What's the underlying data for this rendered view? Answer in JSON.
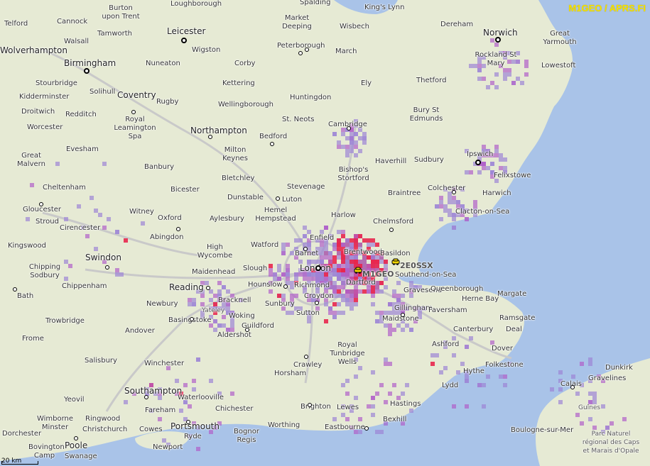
{
  "attribution": "M1GEO / APRS.FI",
  "scale_label": "20 km",
  "colors": {
    "land": "#e6ead4",
    "sea": "#a9c3e8",
    "motorway": "#c9c9c9",
    "coverage_low": "#9c84d6",
    "coverage_mid": "#b05fc9",
    "coverage_high": "#e8274e",
    "attribution": "#f5e200"
  },
  "stations": [
    {
      "callsign": "M1GEO",
      "icon": "car-icon"
    },
    {
      "callsign": "2E0SSX",
      "icon": "car-icon"
    }
  ],
  "places": [
    {
      "name": "Loughborough"
    },
    {
      "name": "Spalding"
    },
    {
      "name": "King's Lynn"
    },
    {
      "name": "Burton upon Trent"
    },
    {
      "name": "Telford"
    },
    {
      "name": "Cannock"
    },
    {
      "name": "Market Deeping"
    },
    {
      "name": "Wisbech"
    },
    {
      "name": "Dereham"
    },
    {
      "name": "Norwich"
    },
    {
      "name": "Great Yarmouth"
    },
    {
      "name": "Tamworth"
    },
    {
      "name": "Leicester"
    },
    {
      "name": "Walsall"
    },
    {
      "name": "Wolverhampton"
    },
    {
      "name": "Wigston"
    },
    {
      "name": "Peterborough"
    },
    {
      "name": "March"
    },
    {
      "name": "Rockland St Mary"
    },
    {
      "name": "Lowestoft"
    },
    {
      "name": "Birmingham"
    },
    {
      "name": "Nuneaton"
    },
    {
      "name": "Corby"
    },
    {
      "name": "Stourbridge"
    },
    {
      "name": "Solihull"
    },
    {
      "name": "Kettering"
    },
    {
      "name": "Ely"
    },
    {
      "name": "Thetford"
    },
    {
      "name": "Kidderminster"
    },
    {
      "name": "Coventry"
    },
    {
      "name": "Huntingdon"
    },
    {
      "name": "Rugby"
    },
    {
      "name": "Wellingborough"
    },
    {
      "name": "Bury St Edmunds"
    },
    {
      "name": "Droitwich"
    },
    {
      "name": "Redditch"
    },
    {
      "name": "St. Neots"
    },
    {
      "name": "Cambridge"
    },
    {
      "name": "Worcester"
    },
    {
      "name": "Royal Leamington Spa"
    },
    {
      "name": "Northampton"
    },
    {
      "name": "Bedford"
    },
    {
      "name": "Evesham"
    },
    {
      "name": "Milton Keynes"
    },
    {
      "name": "Ipswich"
    },
    {
      "name": "Great Malvern"
    },
    {
      "name": "Haverhill"
    },
    {
      "name": "Sudbury"
    },
    {
      "name": "Felixstowe"
    },
    {
      "name": "Banbury"
    },
    {
      "name": "Bletchley"
    },
    {
      "name": "Bishop's Stortford"
    },
    {
      "name": "Cheltenham"
    },
    {
      "name": "Stevenage"
    },
    {
      "name": "Braintree"
    },
    {
      "name": "Colchester"
    },
    {
      "name": "Harwich"
    },
    {
      "name": "Bicester"
    },
    {
      "name": "Dunstable"
    },
    {
      "name": "Luton"
    },
    {
      "name": "Gloucester"
    },
    {
      "name": "Witney"
    },
    {
      "name": "Clacton-on-Sea"
    },
    {
      "name": "Hemel Hempstead"
    },
    {
      "name": "Harlow"
    },
    {
      "name": "Oxford"
    },
    {
      "name": "Aylesbury"
    },
    {
      "name": "Stroud"
    },
    {
      "name": "Cirencester"
    },
    {
      "name": "Chelmsford"
    },
    {
      "name": "Abingdon"
    },
    {
      "name": "Enfield"
    },
    {
      "name": "Kingswood"
    },
    {
      "name": "Watford"
    },
    {
      "name": "High Wycombe"
    },
    {
      "name": "Barnet"
    },
    {
      "name": "Brentwood"
    },
    {
      "name": "Basildon"
    },
    {
      "name": "Swindon"
    },
    {
      "name": "Chipping Sodbury"
    },
    {
      "name": "London"
    },
    {
      "name": "Slough"
    },
    {
      "name": "Maidenhead"
    },
    {
      "name": "Southend-on-Sea"
    },
    {
      "name": "Chippenham"
    },
    {
      "name": "Reading"
    },
    {
      "name": "Hounslow"
    },
    {
      "name": "Richmond"
    },
    {
      "name": "Dartford"
    },
    {
      "name": "Bath"
    },
    {
      "name": "Gravesend"
    },
    {
      "name": "Queenborough"
    },
    {
      "name": "Croydon"
    },
    {
      "name": "Bracknell"
    },
    {
      "name": "Sunbury"
    },
    {
      "name": "Margate"
    },
    {
      "name": "Newbury"
    },
    {
      "name": "Herne Bay"
    },
    {
      "name": "Yateley"
    },
    {
      "name": "Woking"
    },
    {
      "name": "Sutton"
    },
    {
      "name": "Gillingham"
    },
    {
      "name": "Faversham"
    },
    {
      "name": "Trowbridge"
    },
    {
      "name": "Basingstoke"
    },
    {
      "name": "Maidstone"
    },
    {
      "name": "Ramsgate"
    },
    {
      "name": "Guildford"
    },
    {
      "name": "Andover"
    },
    {
      "name": "Aldershot"
    },
    {
      "name": "Canterbury"
    },
    {
      "name": "Deal"
    },
    {
      "name": "Frome"
    },
    {
      "name": "Royal Tunbridge Wells"
    },
    {
      "name": "Ashford"
    },
    {
      "name": "Dover"
    },
    {
      "name": "Salisbury"
    },
    {
      "name": "Winchester"
    },
    {
      "name": "Crawley"
    },
    {
      "name": "Horsham"
    },
    {
      "name": "Folkestone"
    },
    {
      "name": "Hythe"
    },
    {
      "name": "Dunkirk"
    },
    {
      "name": "Lydd"
    },
    {
      "name": "Southampton"
    },
    {
      "name": "Calais"
    },
    {
      "name": "Gravelines"
    },
    {
      "name": "Yeovil"
    },
    {
      "name": "Waterlooville"
    },
    {
      "name": "Hastings"
    },
    {
      "name": "Brighton"
    },
    {
      "name": "Lewes"
    },
    {
      "name": "Guînes"
    },
    {
      "name": "Wimborne Minster"
    },
    {
      "name": "Ringwood"
    },
    {
      "name": "Fareham"
    },
    {
      "name": "Chichester"
    },
    {
      "name": "Bexhill"
    },
    {
      "name": "Portsmouth"
    },
    {
      "name": "Worthing"
    },
    {
      "name": "Eastbourne"
    },
    {
      "name": "Dorchester"
    },
    {
      "name": "Christchurch"
    },
    {
      "name": "Cowes"
    },
    {
      "name": "Bognor Regis"
    },
    {
      "name": "Boulogne-sur-Mer"
    },
    {
      "name": "Parc Naturel régional des Caps et Marais d'Opale"
    },
    {
      "name": "Ryde"
    },
    {
      "name": "Poole"
    },
    {
      "name": "Bovington Camp"
    },
    {
      "name": "Swanage"
    },
    {
      "name": "Newport"
    }
  ]
}
